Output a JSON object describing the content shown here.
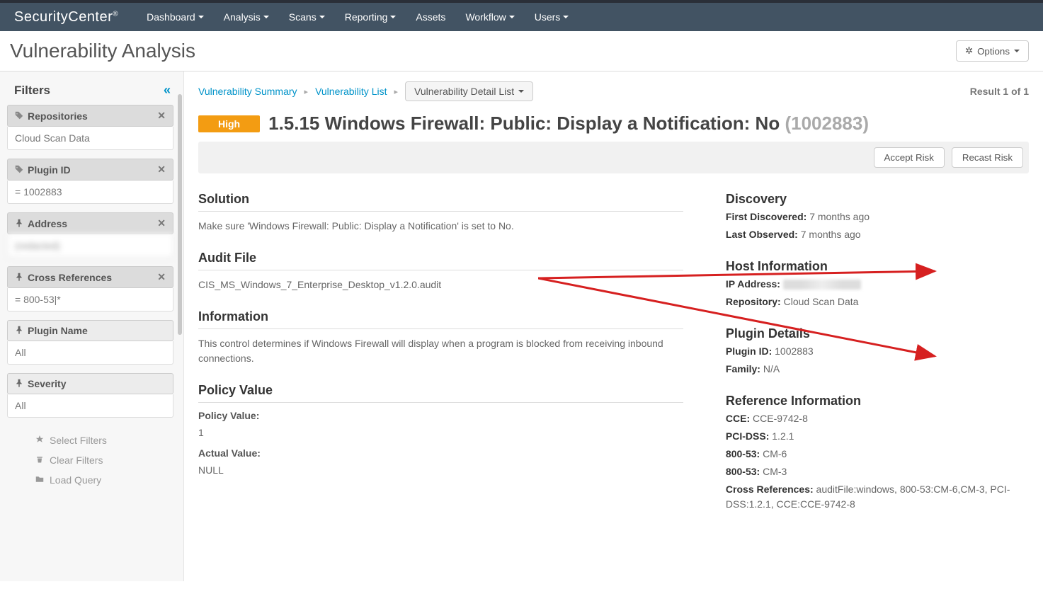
{
  "brand": "SecurityCenter",
  "nav": [
    "Dashboard",
    "Analysis",
    "Scans",
    "Reporting",
    "Assets",
    "Workflow",
    "Users"
  ],
  "nav_hascaret": [
    true,
    true,
    true,
    true,
    false,
    true,
    true
  ],
  "pageTitle": "Vulnerability Analysis",
  "optionsLabel": "Options",
  "filters": {
    "title": "Filters",
    "items": [
      {
        "icon": "tag",
        "label": "Repositories",
        "value": "Cloud Scan Data",
        "closable": true,
        "headerStyle": "dark"
      },
      {
        "icon": "tag",
        "label": "Plugin ID",
        "value": "= 1002883",
        "closable": true,
        "headerStyle": "dark"
      },
      {
        "icon": "pin",
        "label": "Address",
        "value": "(redacted)",
        "blur": true,
        "closable": true,
        "headerStyle": "dark"
      },
      {
        "icon": "pin",
        "label": "Cross References",
        "value": "= 800-53|*",
        "closable": true,
        "headerStyle": "dark"
      },
      {
        "icon": "pin",
        "label": "Plugin Name",
        "value": "All",
        "closable": false,
        "headerStyle": "light"
      },
      {
        "icon": "pin",
        "label": "Severity",
        "value": "All",
        "closable": false,
        "headerStyle": "light"
      }
    ],
    "actions": {
      "select": "Select Filters",
      "clear": "Clear Filters",
      "load": "Load Query"
    }
  },
  "breadcrumbs": {
    "a": "Vulnerability Summary",
    "b": "Vulnerability List",
    "dropdown": "Vulnerability Detail List"
  },
  "resultsText": "Result 1 of 1",
  "severity": "High",
  "vulnTitle": "1.5.15 Windows Firewall: Public: Display a Notification: No",
  "vulnId": "(1002883)",
  "buttons": {
    "accept": "Accept Risk",
    "recast": "Recast Risk"
  },
  "sections": {
    "solution": {
      "h": "Solution",
      "text": "Make sure 'Windows Firewall: Public: Display a Notification' is set to No."
    },
    "auditFile": {
      "h": "Audit File",
      "text": "CIS_MS_Windows_7_Enterprise_Desktop_v1.2.0.audit"
    },
    "information": {
      "h": "Information",
      "text": "This control determines if Windows Firewall will display when a program is blocked from receiving inbound connections."
    },
    "policy": {
      "h": "Policy Value",
      "pvLabel": "Policy Value:",
      "pv": "1",
      "avLabel": "Actual Value:",
      "av": "NULL"
    }
  },
  "side": {
    "discovery": {
      "h": "Discovery",
      "rows": [
        {
          "k": "First Discovered:",
          "v": "7 months ago"
        },
        {
          "k": "Last Observed:",
          "v": "7 months ago"
        }
      ]
    },
    "host": {
      "h": "Host Information",
      "ipLabel": "IP Address:",
      "repoLabel": "Repository:",
      "repo": "Cloud Scan Data"
    },
    "plugin": {
      "h": "Plugin Details",
      "rows": [
        {
          "k": "Plugin ID:",
          "v": "1002883"
        },
        {
          "k": "Family:",
          "v": "N/A"
        }
      ]
    },
    "ref": {
      "h": "Reference Information",
      "rows": [
        {
          "k": "CCE:",
          "v": "CCE-9742-8"
        },
        {
          "k": "PCI-DSS:",
          "v": "1.2.1"
        },
        {
          "k": "800-53:",
          "v": "CM-6"
        },
        {
          "k": "800-53:",
          "v": "CM-3"
        },
        {
          "k": "Cross References:",
          "v": "auditFile:windows, 800-53:CM-6,CM-3, PCI-DSS:1.2.1, CCE:CCE-9742-8"
        }
      ]
    }
  }
}
